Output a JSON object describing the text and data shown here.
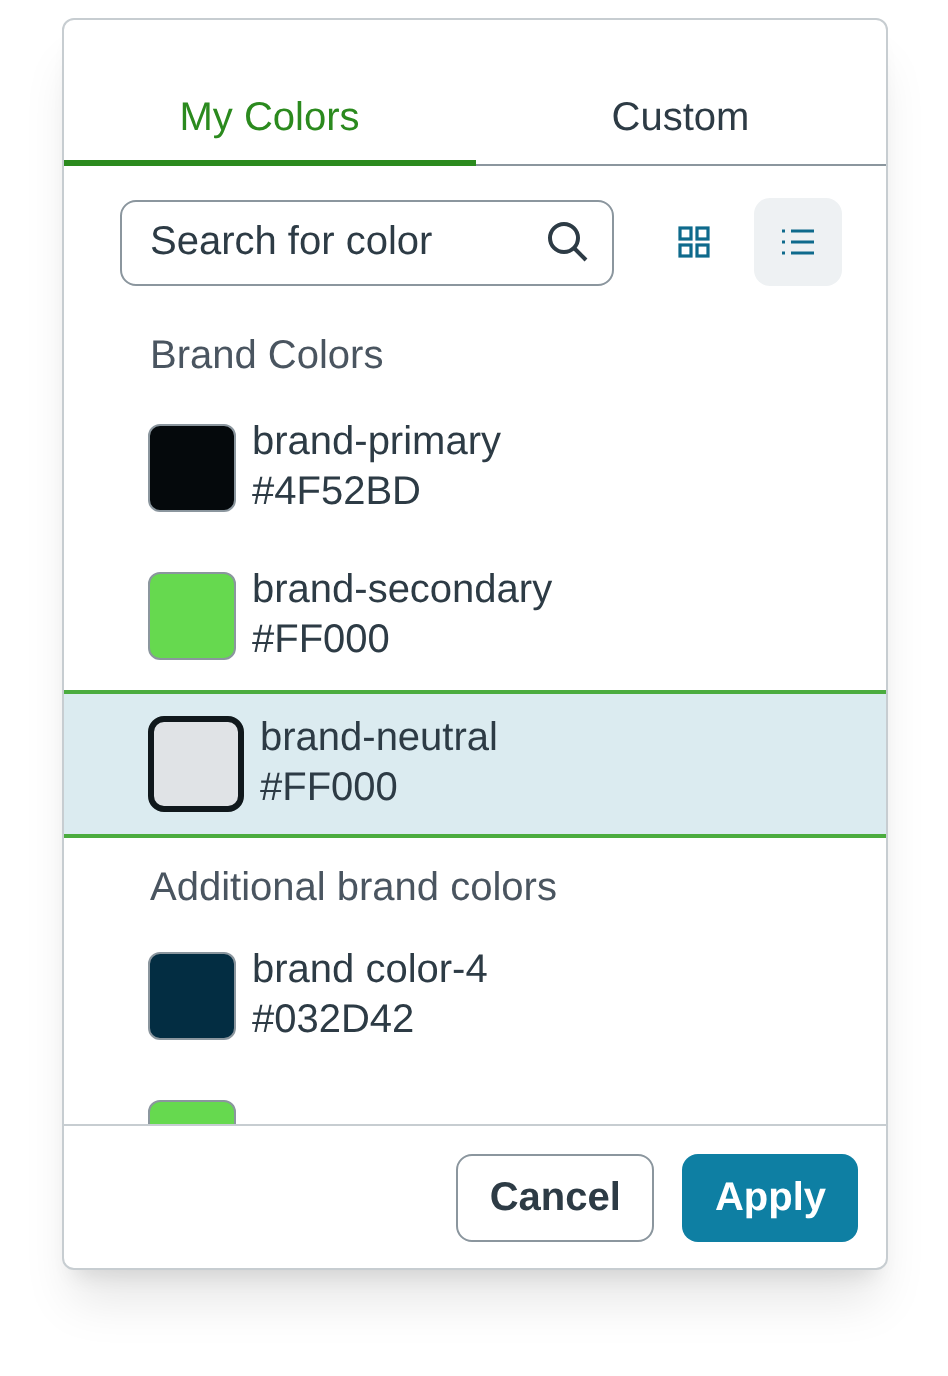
{
  "tabs": [
    {
      "label": "My Colors",
      "selected": true
    },
    {
      "label": "Custom",
      "selected": false
    }
  ],
  "search": {
    "placeholder": "Search for color"
  },
  "view_toggle": [
    {
      "kind": "grid",
      "selected": false
    },
    {
      "kind": "list",
      "selected": true
    }
  ],
  "groups": [
    {
      "title": "Brand Colors",
      "items": [
        {
          "name": "brand-primary",
          "hex": "#4F52BD",
          "color": "#05090c",
          "selected": false
        },
        {
          "name": "brand-secondary",
          "hex": "#FF000",
          "color": "#66d94f",
          "selected": false
        },
        {
          "name": "brand-neutral",
          "hex": "#FF000",
          "color": "#e0e3e6",
          "selected": true
        }
      ]
    },
    {
      "title": "Additional brand colors",
      "items": [
        {
          "name": "brand color-4",
          "hex": "#032D42",
          "color": "#032d42",
          "selected": false
        },
        {
          "color": "#66d94f",
          "selected": false
        }
      ]
    }
  ],
  "buttons": [
    {
      "label": "Cancel",
      "kind": "secondary"
    },
    {
      "label": "Apply",
      "kind": "primary"
    }
  ]
}
